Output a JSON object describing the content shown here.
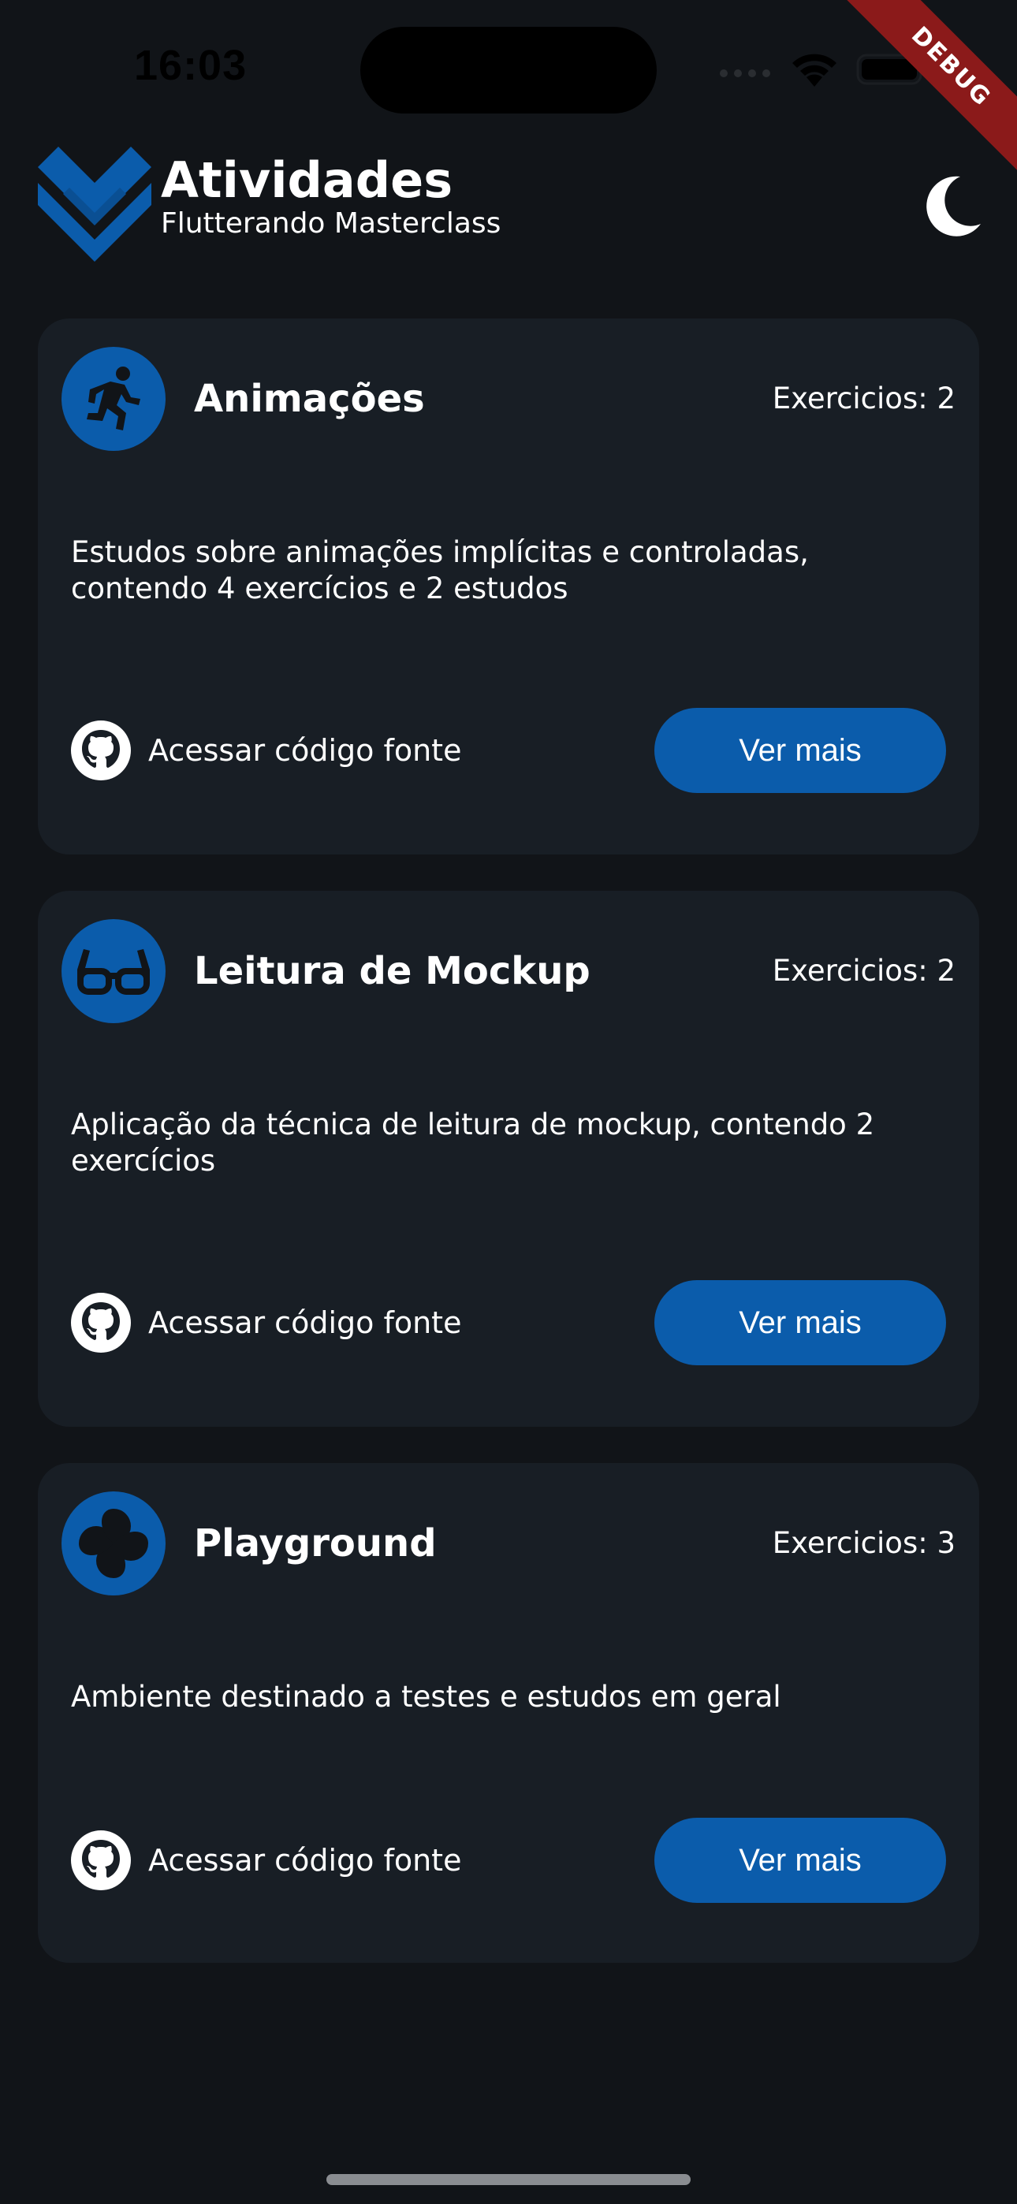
{
  "status_bar": {
    "time": "16:03"
  },
  "debug_banner": "DEBUG",
  "header": {
    "title": "Atividades",
    "subtitle": "Flutterando Masterclass",
    "logo_icon": "flutterando-logo-icon",
    "theme_toggle_icon": "moon-icon"
  },
  "colors": {
    "background": "#111418",
    "card": "#181e25",
    "accent": "#0b5cab",
    "logo": "#0b5cab",
    "debug_ribbon": "#8b1a1a"
  },
  "cards": [
    {
      "icon": "running-person-icon",
      "title": "Animações",
      "count": "Exercicios: 2",
      "description": "Estudos sobre animações implícitas e controladas, contendo 4 exercícios e 2 estudos",
      "github_label": "Acessar código fonte",
      "button_label": "Ver mais"
    },
    {
      "icon": "eyeglasses-icon",
      "title": "Leitura de Mockup",
      "count": "Exercicios: 2",
      "description": "Aplicação da técnica de leitura de mockup, contendo 2 exercícios",
      "github_label": "Acessar código fonte",
      "button_label": "Ver mais"
    },
    {
      "icon": "pinwheel-icon",
      "title": "Playground",
      "count": "Exercicios: 3",
      "description": "Ambiente destinado a testes e estudos em geral",
      "github_label": "Acessar código fonte",
      "button_label": "Ver mais"
    }
  ]
}
